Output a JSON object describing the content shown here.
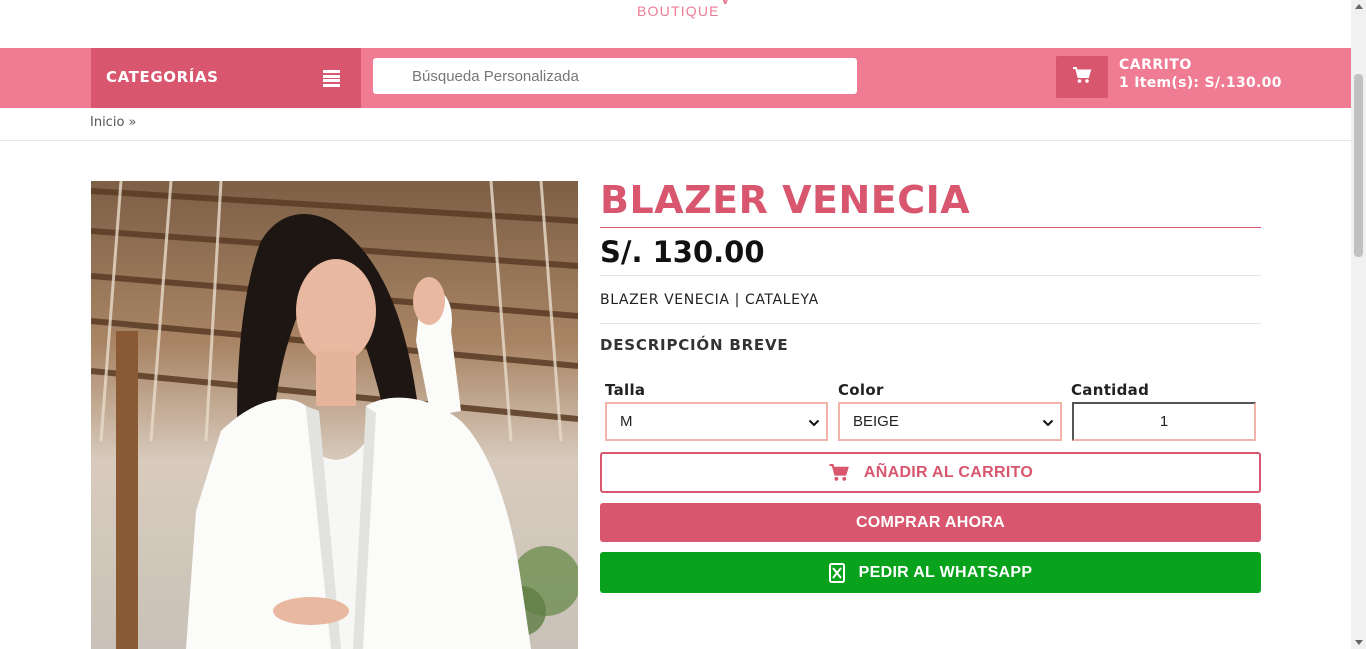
{
  "brand": {
    "subtitle": "BOUTIQUE"
  },
  "header": {
    "categories_label": "CATEGORÍAS",
    "search_placeholder": "Búsqueda Personalizada",
    "cart_title": "CARRITO",
    "cart_summary": "1 Item(s): S/.130.00"
  },
  "breadcrumb": {
    "home": "Inicio",
    "separator": "»"
  },
  "product": {
    "title": "BLAZER VENECIA",
    "price": "S/. 130.00",
    "subtitle": "BLAZER VENECIA | CATALEYA",
    "description_heading": "DESCRIPCIÓN BREVE",
    "size_label": "Talla",
    "size_value": "M",
    "color_label": "Color",
    "color_value": "BEIGE",
    "quantity_label": "Cantidad",
    "quantity_value": "1"
  },
  "actions": {
    "add_to_cart": "AÑADIR AL CARRITO",
    "buy_now": "COMPRAR AHORA",
    "whatsapp": "PEDIR AL WHATSAPP"
  },
  "icons": {
    "menu": "hamburger-menu-icon",
    "cart": "shopping-cart-icon",
    "whatsapp": "whatsapp-icon"
  },
  "colors": {
    "brand_pink": "#ef7c93",
    "brand_dark_pink": "#d9566f",
    "whatsapp_green": "#08a21c"
  }
}
